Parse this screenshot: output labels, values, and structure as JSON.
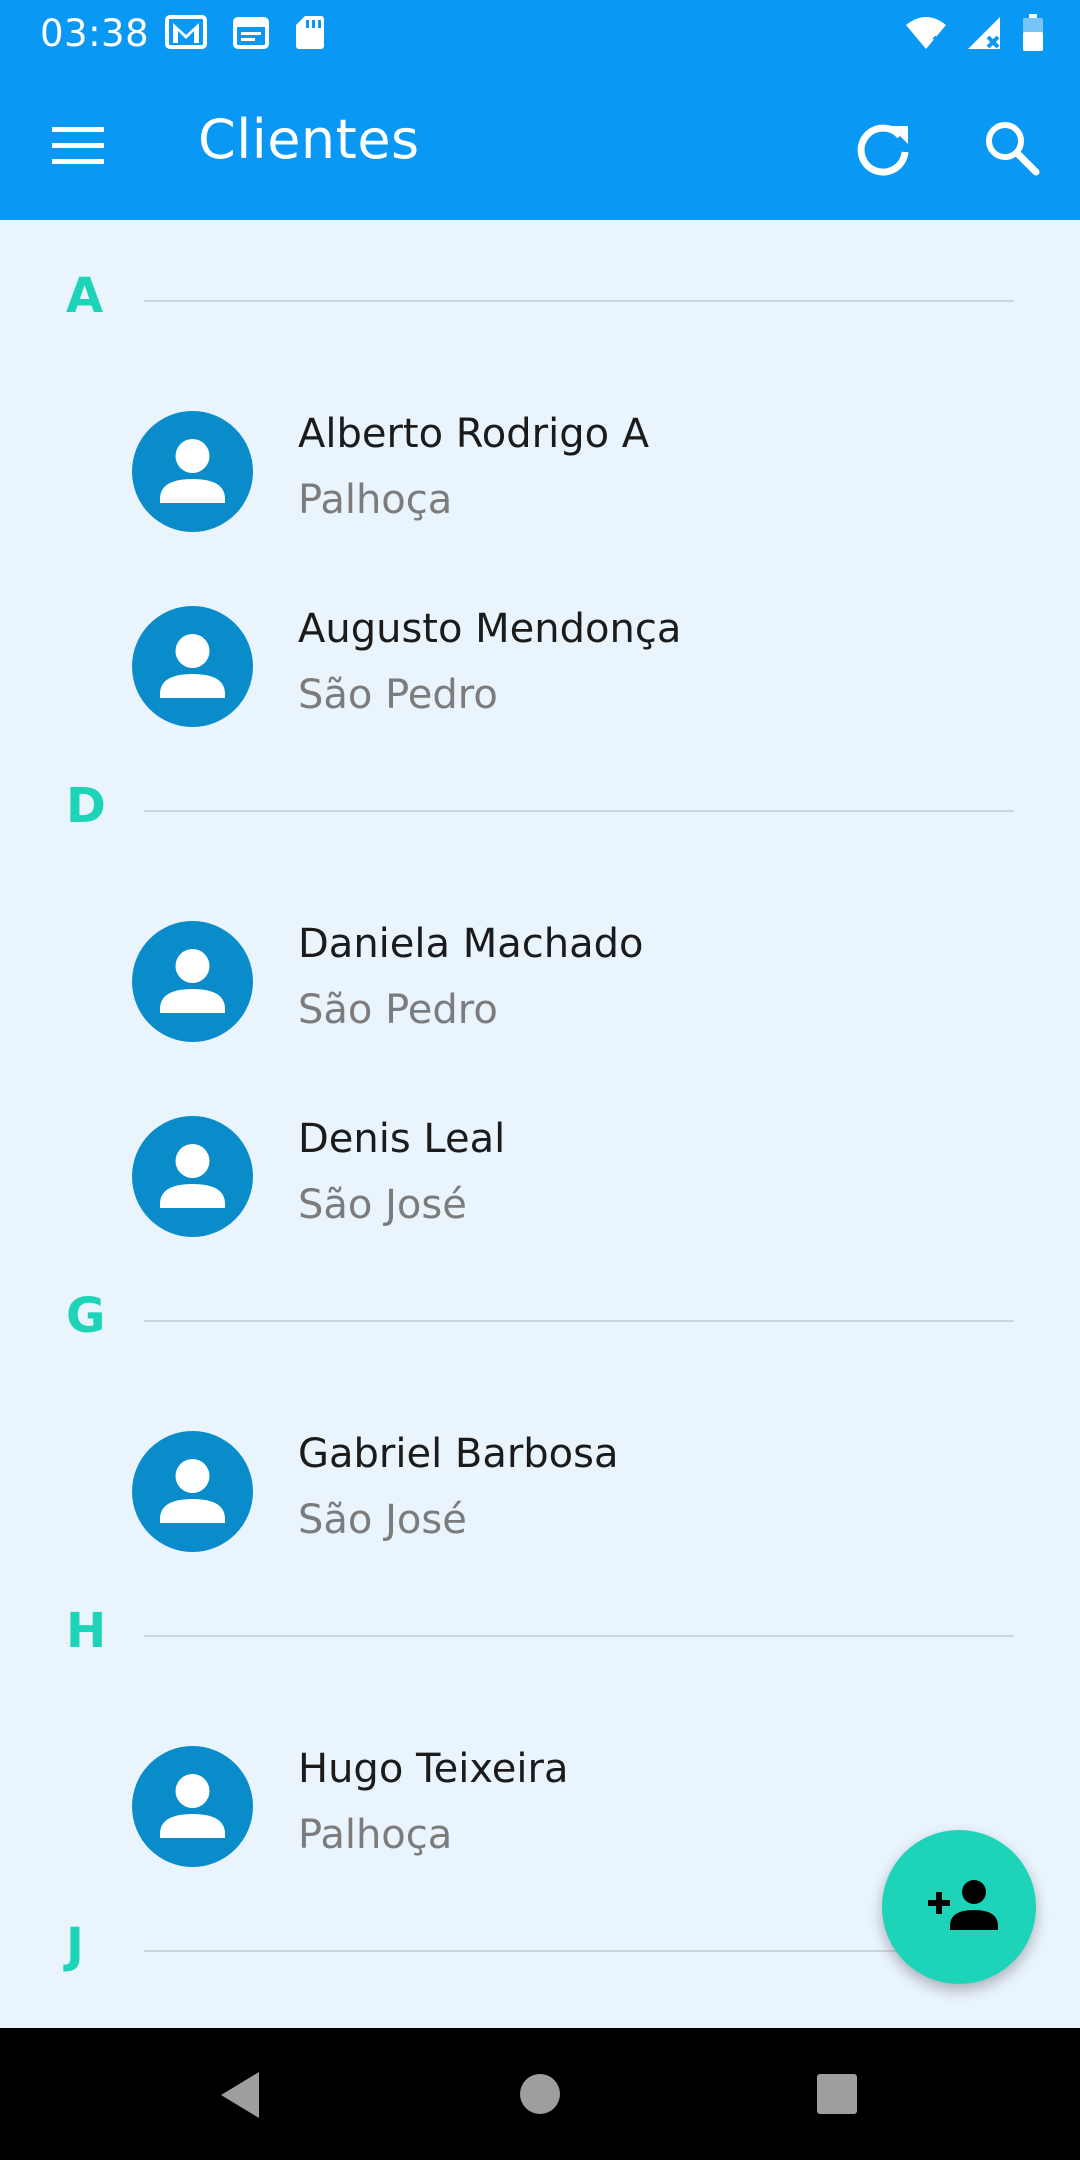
{
  "status_bar": {
    "time": "03:38",
    "left_icons": [
      "gmail-icon",
      "calendar-icon",
      "sd-card-icon"
    ],
    "right_icons": [
      "wifi-off-icon",
      "signal-off-icon",
      "battery-icon"
    ]
  },
  "app_bar": {
    "title": "Clientes",
    "actions": [
      "refresh-icon",
      "search-icon"
    ],
    "color": "#0A98F5"
  },
  "theme": {
    "section_letter_color": "#1DD3B8",
    "avatar_color": "#0A8CCB",
    "fab_color": "#1DD3B8",
    "background": "#EAF4FD"
  },
  "sections": [
    {
      "letter": "A",
      "clients": [
        {
          "name": "Alberto Rodrigo A",
          "city": "Palhoça"
        },
        {
          "name": "Augusto Mendonça",
          "city": "São Pedro"
        }
      ]
    },
    {
      "letter": "D",
      "clients": [
        {
          "name": "Daniela Machado",
          "city": "São Pedro"
        },
        {
          "name": "Denis Leal",
          "city": "São José"
        }
      ]
    },
    {
      "letter": "G",
      "clients": [
        {
          "name": "Gabriel Barbosa",
          "city": "São José"
        }
      ]
    },
    {
      "letter": "H",
      "clients": [
        {
          "name": "Hugo Teixeira",
          "city": "Palhoça"
        }
      ]
    },
    {
      "letter": "J",
      "clients": []
    }
  ],
  "fab": {
    "icon": "add-person-icon"
  },
  "nav_bar": {
    "buttons": [
      "back-icon",
      "home-icon",
      "recents-icon"
    ]
  }
}
